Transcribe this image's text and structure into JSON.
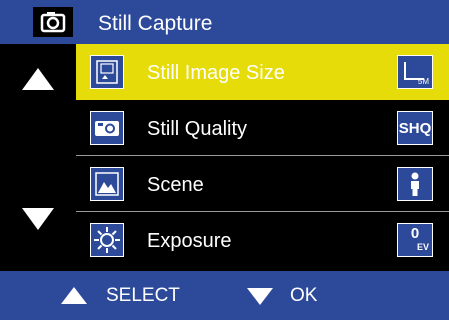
{
  "header": {
    "icon": "camera-icon",
    "title": "Still Capture"
  },
  "nav": {
    "up_icon": "arrow-up-icon",
    "down_icon": "arrow-down-icon"
  },
  "menu": {
    "items": [
      {
        "label": "Still Image Size",
        "icon": "image-size-icon",
        "value": "5M",
        "value_icon": "image-size-5m-icon",
        "selected": true
      },
      {
        "label": "Still Quality",
        "icon": "quality-icon",
        "value": "SHQ",
        "selected": false
      },
      {
        "label": "Scene",
        "icon": "scene-mountain-icon",
        "value_icon": "portrait-person-icon",
        "selected": false
      },
      {
        "label": "Exposure",
        "icon": "exposure-sun-icon",
        "value": "0",
        "value_unit": "EV",
        "selected": false
      }
    ]
  },
  "footer": {
    "select_label": "SELECT",
    "ok_label": "OK"
  },
  "colors": {
    "accent_blue": "#2d4a9a",
    "highlight_yellow": "#e6dc0a",
    "background": "#000000",
    "text": "#ffffff"
  }
}
